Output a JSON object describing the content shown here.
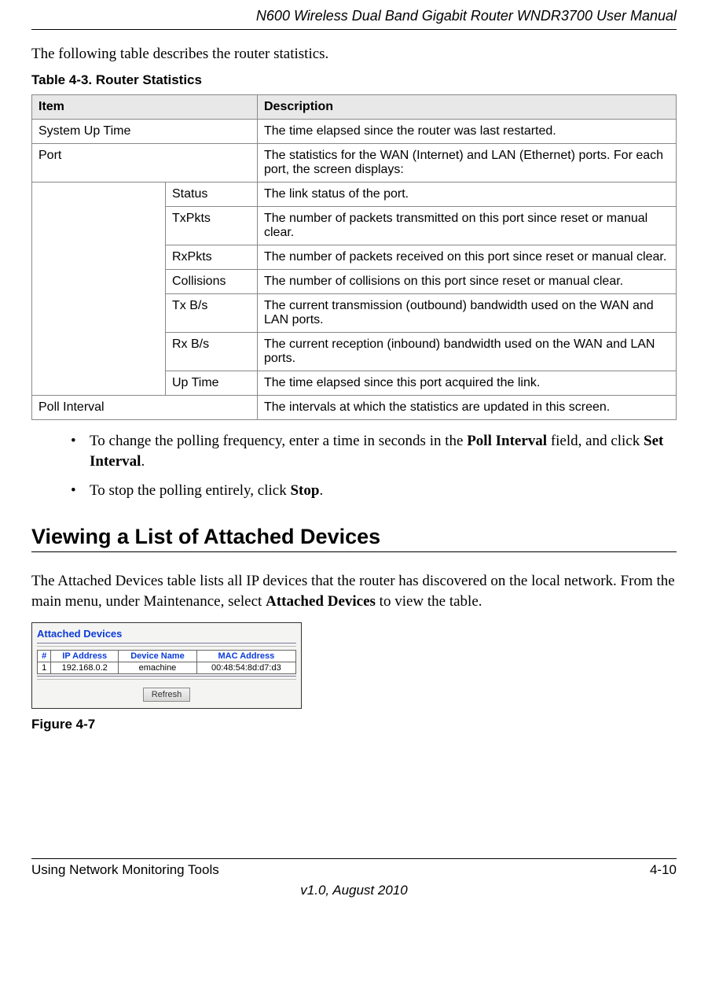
{
  "header": {
    "title": "N600 Wireless Dual Band Gigabit Router WNDR3700 User Manual"
  },
  "intro": "The following table describes the router statistics.",
  "table_caption": "Table 4-3.  Router Statistics",
  "table_headers": {
    "item": "Item",
    "description": "Description"
  },
  "rows": {
    "system_up_time": {
      "item": "System Up Time",
      "desc": "The time elapsed since the router was last restarted."
    },
    "port": {
      "item": "Port",
      "desc": "The statistics for the WAN (Internet) and LAN (Ethernet) ports. For each port, the screen displays:"
    },
    "status": {
      "item": "Status",
      "desc": "The link status of the port."
    },
    "txpkts": {
      "item": "TxPkts",
      "desc": "The number of packets transmitted on this port since reset or manual clear."
    },
    "rxpkts": {
      "item": "RxPkts",
      "desc": "The number of packets received on this port since reset or manual clear."
    },
    "collisions": {
      "item": "Collisions",
      "desc": "The number of collisions on this port since reset or manual clear."
    },
    "txbs": {
      "item": "Tx B/s",
      "desc": "The current transmission (outbound) bandwidth used on the WAN and LAN ports."
    },
    "rxbs": {
      "item": "Rx B/s",
      "desc": "The current reception (inbound) bandwidth used on the WAN and LAN ports."
    },
    "uptime": {
      "item": "Up Time",
      "desc": "The time elapsed since this port acquired the link."
    },
    "poll": {
      "item": "Poll Interval",
      "desc": "The intervals at which the statistics are updated in this screen."
    }
  },
  "bullets": {
    "b1a": "To change the polling frequency, enter a time in seconds in the ",
    "b1b": "Poll Interval",
    "b1c": " field, and click ",
    "b1d": "Set Interval",
    "b1e": ".",
    "b2a": "To stop the polling entirely, click ",
    "b2b": "Stop",
    "b2c": "."
  },
  "section_title": "Viewing a List of Attached Devices",
  "section_body_a": "The Attached Devices table lists all IP devices that the router has discovered on the local network. From the main menu, under Maintenance, select ",
  "section_body_b": "Attached Devices",
  "section_body_c": " to view the table.",
  "figure": {
    "title": "Attached Devices",
    "headers": {
      "num": "#",
      "ip": "IP Address",
      "device": "Device Name",
      "mac": "MAC Address"
    },
    "row": {
      "num": "1",
      "ip": "192.168.0.2",
      "device": "emachine",
      "mac": "00:48:54:8d:d7:d3"
    },
    "refresh": "Refresh",
    "label": "Figure 4-7"
  },
  "footer": {
    "left": "Using Network Monitoring Tools",
    "right": "4-10",
    "version": "v1.0, August 2010"
  }
}
